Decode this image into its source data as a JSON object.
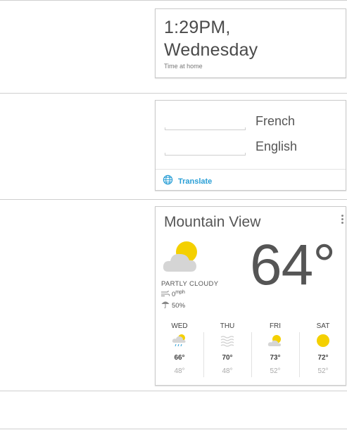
{
  "time_card": {
    "time": "1:29PM,",
    "day": "Wednesday",
    "caption": "Time at home"
  },
  "translate_card": {
    "source_language": "French",
    "target_language": "English",
    "action_label": "Translate",
    "accent_color": "#2a9fd6"
  },
  "weather_card": {
    "city": "Mountain View",
    "temperature": "64°",
    "condition": "PARTLY CLOUDY",
    "wind_value": "0",
    "wind_unit": "mph",
    "precip": "50%",
    "forecast": [
      {
        "day": "WED",
        "icon": "rain-cloud-icon",
        "high": "66°",
        "low": "48°"
      },
      {
        "day": "THU",
        "icon": "fog-icon",
        "high": "70°",
        "low": "48°"
      },
      {
        "day": "FRI",
        "icon": "partly-cloudy-icon",
        "high": "73°",
        "low": "52°"
      },
      {
        "day": "SAT",
        "icon": "sun-icon",
        "high": "72°",
        "low": "52°"
      }
    ],
    "sun_color": "#f4d000"
  }
}
